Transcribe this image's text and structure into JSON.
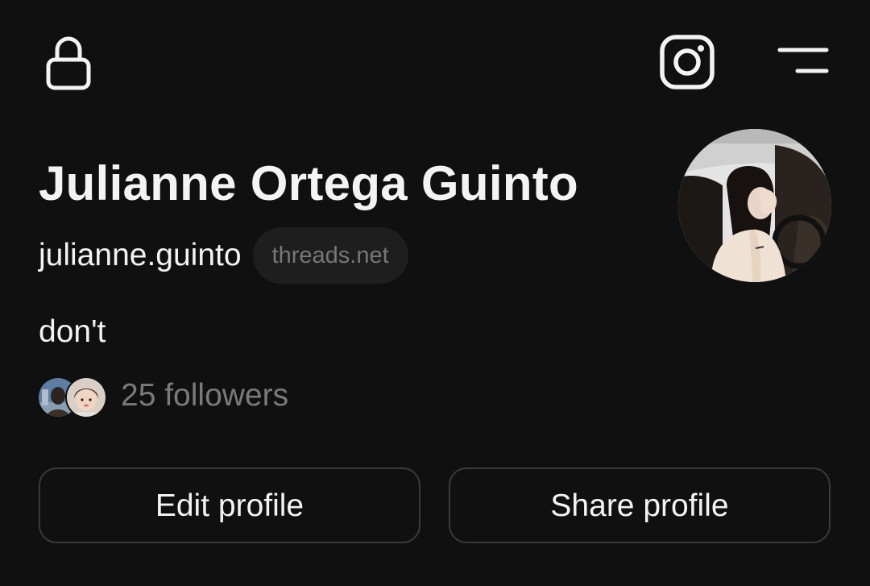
{
  "header": {
    "left_icon": "lock-icon",
    "right_icons": [
      "instagram-icon",
      "menu-icon"
    ]
  },
  "profile": {
    "name": "Julianne Ortega Guinto",
    "handle": "julianne.guinto",
    "domain": "threads.net",
    "bio": "don't",
    "followers_label": "25 followers"
  },
  "actions": {
    "edit_label": "Edit profile",
    "share_label": "Share profile"
  },
  "colors": {
    "background": "#101010",
    "text": "#f3f3f3",
    "muted": "#7a7a7a",
    "pill_bg": "#1e1e1e",
    "border": "#3a3a3a"
  }
}
